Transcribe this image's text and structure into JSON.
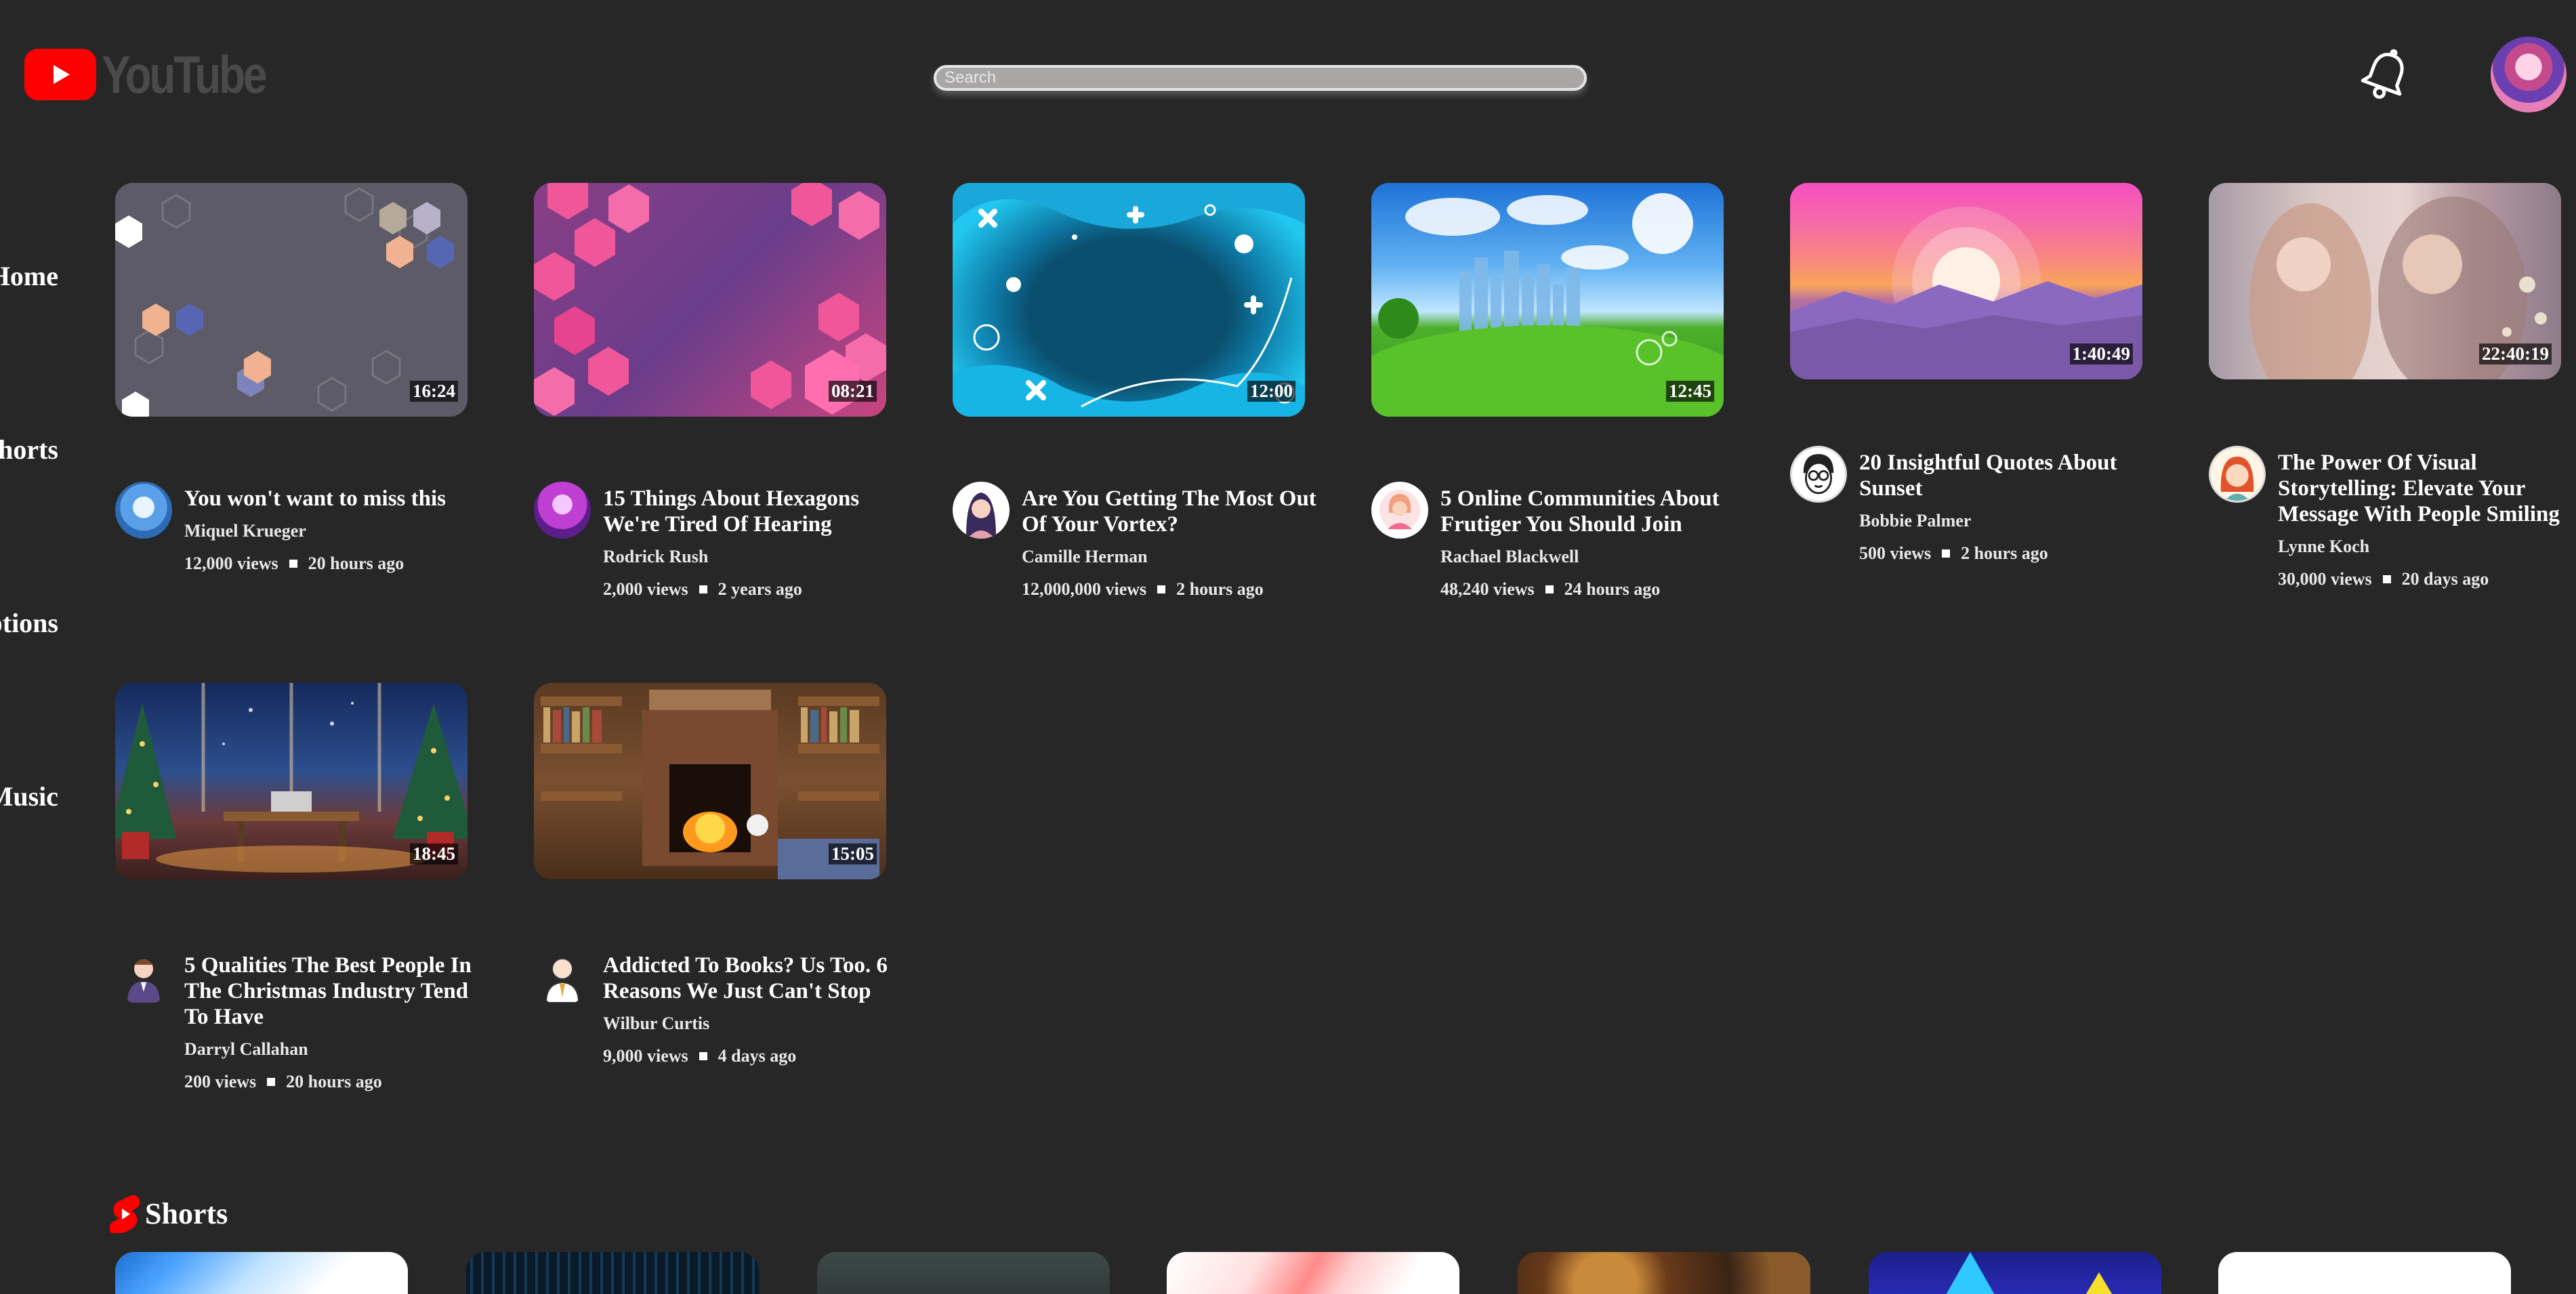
{
  "header": {
    "logo_text": "YouTube",
    "search_placeholder": "Search"
  },
  "sidebar": {
    "items": [
      {
        "label": "Home"
      },
      {
        "label": "Shorts"
      },
      {
        "label": "Subscriptions"
      },
      {
        "label": "Music"
      }
    ]
  },
  "videos": [
    {
      "title": "You won't want to miss this",
      "channel": "Miquel Krueger",
      "views": "12,000 views",
      "age": "20 hours ago",
      "duration": "16:24"
    },
    {
      "title": "15 Things About Hexagons We're Tired Of Hearing",
      "channel": "Rodrick Rush",
      "views": "2,000 views",
      "age": "2 years ago",
      "duration": "08:21"
    },
    {
      "title": "Are You Getting The Most Out Of Your Vortex?",
      "channel": "Camille Herman",
      "views": "12,000,000 views",
      "age": "2 hours ago",
      "duration": "12:00"
    },
    {
      "title": "5 Online Communities About Frutiger You Should Join",
      "channel": "Rachael Blackwell",
      "views": "48,240 views",
      "age": "24 hours ago",
      "duration": "12:45"
    },
    {
      "title": "20 Insightful Quotes About Sunset",
      "channel": "Bobbie Palmer",
      "views": "500 views",
      "age": "2 hours ago",
      "duration": "1:40:49"
    },
    {
      "title": "The Power Of Visual Storytelling: Elevate Your Message With People Smiling",
      "channel": "Lynne Koch",
      "views": "30,000 views",
      "age": "20 days ago",
      "duration": "22:40:19"
    },
    {
      "title": "5 Qualities The Best People In The Christmas Industry Tend To Have",
      "channel": "Darryl Callahan",
      "views": "200 views",
      "age": "20 hours ago",
      "duration": "18:45"
    },
    {
      "title": "Addicted To Books? Us Too. 6 Reasons We Just Can't Stop",
      "channel": "Wilbur Curtis",
      "views": "9,000 views",
      "age": "4 days ago",
      "duration": "15:05"
    }
  ],
  "shorts": {
    "label": "Shorts"
  },
  "colors": {
    "background": "#272727",
    "brand_red": "#ff0000"
  }
}
